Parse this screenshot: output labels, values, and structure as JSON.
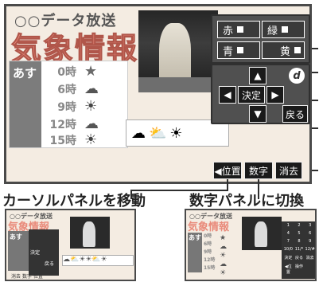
{
  "main": {
    "channel_name": "○○データ放送",
    "app_title": "気象情報",
    "day_label": "あす",
    "forecast_rows": [
      {
        "hour": "0時",
        "icon": "star-icon",
        "glyph": "★",
        "color": "#6a6a6a"
      },
      {
        "hour": "6時",
        "icon": "cloud-icon",
        "glyph": "☁",
        "color": "#555555"
      },
      {
        "hour": "9時",
        "icon": "sun-icon",
        "glyph": "☀",
        "color": "#444444"
      },
      {
        "hour": "12時",
        "icon": "cloud-icon",
        "glyph": "☁",
        "color": "#555555"
      },
      {
        "hour": "15時",
        "icon": "sun-icon",
        "glyph": "☀",
        "color": "#444444"
      }
    ],
    "strip_icons": [
      {
        "icon": "cloud-icon",
        "glyph": "☁"
      },
      {
        "icon": "sun-cloud-icon",
        "glyph": "⛅"
      },
      {
        "icon": "sun-icon",
        "glyph": "☀"
      }
    ]
  },
  "color_keys": {
    "red": "赤",
    "green": "緑",
    "blue": "青",
    "yellow": "黄"
  },
  "dpad": {
    "up": "▲",
    "down": "▼",
    "left": "◀",
    "right": "▶",
    "center": "決定",
    "d_button": "d",
    "back": "戻る"
  },
  "bottom_keys": {
    "position": "◀位置",
    "numbers": "数字",
    "erase": "消去"
  },
  "captions": {
    "move_cursor_panel": "カーソルパネルを移動",
    "switch_number_panel": "数字パネルに切換"
  },
  "thumb_left": {
    "channel_name": "○○データ放送",
    "app_title": "気象情報",
    "day_label": "あす",
    "keys": [
      "決定",
      "戻る",
      "消去",
      "数字",
      "位置"
    ]
  },
  "thumb_right": {
    "channel_name": "○○データ放送",
    "app_title": "気象情報",
    "day_label": "あす",
    "hours": [
      "0時",
      "6時",
      "9時",
      "12時",
      "15時"
    ],
    "numpad": [
      "1",
      "2",
      "3",
      "4",
      "5",
      "6",
      "7",
      "8",
      "9",
      "10/0",
      "11/*",
      "12/#",
      "決定",
      "戻る",
      "消去",
      "◀位置",
      "操作"
    ]
  },
  "colors": {
    "title_pink": "#e98a7a",
    "panel_dark": "#505050",
    "screen_bg": "#f4ece2",
    "frame": "#4a4a4a"
  }
}
